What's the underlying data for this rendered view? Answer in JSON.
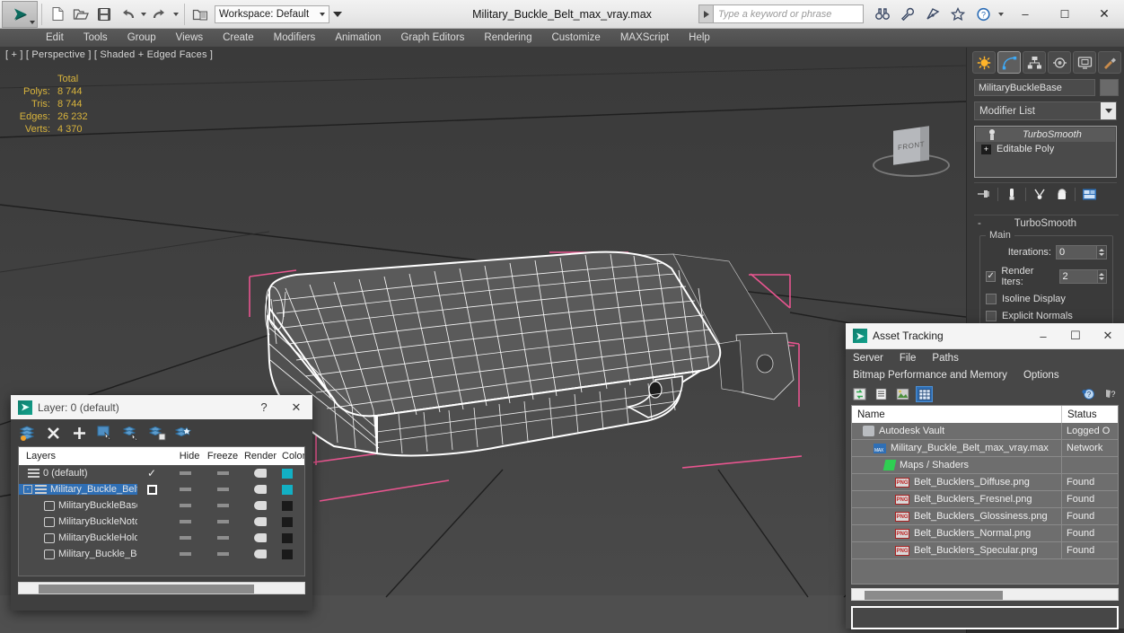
{
  "titlebar": {
    "app_logo": "3dsmax-logo",
    "document_title": "Military_Buckle_Belt_max_vray.max",
    "workspace_label": "Workspace: Default",
    "search_placeholder": "Type a keyword or phrase",
    "quick_buttons": [
      "new-icon",
      "open-icon",
      "save-icon",
      "undo-icon",
      "redo-icon",
      "set-project-icon"
    ],
    "help_icons": [
      "binoculars-icon",
      "wrench-icon",
      "satellite-icon",
      "star-icon",
      "help-icon"
    ],
    "window_buttons": {
      "minimize": "–",
      "maximize": "☐",
      "close": "✕"
    }
  },
  "menubar": {
    "items": [
      "Edit",
      "Tools",
      "Group",
      "Views",
      "Create",
      "Modifiers",
      "Animation",
      "Graph Editors",
      "Rendering",
      "Customize",
      "MAXScript",
      "Help"
    ]
  },
  "viewport": {
    "label": "[ + ] [ Perspective ] [ Shaded + Edged Faces ]",
    "stats": {
      "header": "Total",
      "rows": [
        {
          "key": "Polys:",
          "value": "8 744"
        },
        {
          "key": "Tris:",
          "value": "8 744"
        },
        {
          "key": "Edges:",
          "value": "26 232"
        },
        {
          "key": "Verts:",
          "value": "4 370"
        }
      ]
    },
    "viewcube_label": "FRONT",
    "selection_color": "#e8558f",
    "wire_color": "#ffffff"
  },
  "command_panel": {
    "tabs": [
      "create-tab-icon",
      "modify-tab-icon",
      "hierarchy-tab-icon",
      "motion-tab-icon",
      "display-tab-icon",
      "utilities-tab-icon"
    ],
    "selected_tab_index": 1,
    "object_name": "MilitaryBuckleBase",
    "modifier_list_label": "Modifier List",
    "stack": [
      {
        "label": "TurboSmooth",
        "icon": "lightbulb-icon",
        "selected": true,
        "italic": true
      },
      {
        "label": "Editable Poly",
        "icon": "plus-box-icon",
        "selected": false,
        "italic": false
      }
    ],
    "stack_tools": [
      "pin-stack-icon",
      "show-end-result-icon",
      "make-unique-icon",
      "remove-modifier-icon",
      "configure-sets-icon"
    ],
    "rollout": {
      "title": "TurboSmooth",
      "collapse_glyph": "-",
      "group_label": "Main",
      "iterations_label": "Iterations:",
      "iterations_value": "0",
      "render_iters_label": "Render Iters:",
      "render_iters_value": "2",
      "render_iters_checked": true,
      "isoline_label": "Isoline Display",
      "isoline_checked": false,
      "explicit_normals_label": "Explicit Normals",
      "explicit_normals_checked": false
    }
  },
  "asset_tracking": {
    "title": "Asset Tracking",
    "window_buttons": {
      "minimize": "–",
      "maximize": "☐",
      "close": "✕"
    },
    "menu_row1": [
      "Server",
      "File",
      "Paths"
    ],
    "menu_row2": [
      "Bitmap Performance and Memory",
      "Options"
    ],
    "toolbar_icons": [
      "refresh-icon",
      "list-view-icon",
      "thumbnail-view-icon",
      "grid-view-icon"
    ],
    "help_icons": [
      "help-icon",
      "context-help-icon"
    ],
    "columns": [
      "Name",
      "Status"
    ],
    "rows": [
      {
        "name": "Autodesk Vault",
        "status": "Logged O",
        "icon": "vault-icon",
        "indent": 1
      },
      {
        "name": "Military_Buckle_Belt_max_vray.max",
        "status": "Network",
        "icon": "max-file-icon",
        "indent": 2
      },
      {
        "name": "Maps / Shaders",
        "status": "",
        "icon": "maps-icon",
        "indent": 3
      },
      {
        "name": "Belt_Bucklers_Diffuse.png",
        "status": "Found",
        "icon": "png-icon",
        "indent": 4
      },
      {
        "name": "Belt_Bucklers_Fresnel.png",
        "status": "Found",
        "icon": "png-icon",
        "indent": 4
      },
      {
        "name": "Belt_Bucklers_Glossiness.png",
        "status": "Found",
        "icon": "png-icon",
        "indent": 4
      },
      {
        "name": "Belt_Bucklers_Normal.png",
        "status": "Found",
        "icon": "png-icon",
        "indent": 4
      },
      {
        "name": "Belt_Bucklers_Specular.png",
        "status": "Found",
        "icon": "png-icon",
        "indent": 4
      }
    ]
  },
  "layer_dialog": {
    "title": "Layer: 0 (default)",
    "help_glyph": "?",
    "close_glyph": "✕",
    "toolbar_icons": [
      "new-layer-icon",
      "delete-layer-icon",
      "add-layer-icon",
      "select-objects-icon",
      "highlight-selected-icon",
      "add-selection-icon",
      "select-highlighted-icon"
    ],
    "columns": [
      "Layers",
      "Hide",
      "Freeze",
      "Render",
      "Color"
    ],
    "rows": [
      {
        "name": "0 (default)",
        "indent": 1,
        "icon": "layer-icon",
        "selected": false,
        "current": true,
        "color": "#12b0c4",
        "expander": ""
      },
      {
        "name": "Military_Buckle_Belt",
        "indent": 1,
        "icon": "layer-icon",
        "selected": true,
        "current": false,
        "color": "#12b0c4",
        "expander": "-"
      },
      {
        "name": "MilitaryBuckleBase",
        "indent": 2,
        "icon": "object-icon",
        "selected": false,
        "current": false,
        "color": "#1a1a1a",
        "expander": ""
      },
      {
        "name": "MilitaryBuckleNotched",
        "indent": 2,
        "icon": "object-icon",
        "selected": false,
        "current": false,
        "color": "#1a1a1a",
        "expander": ""
      },
      {
        "name": "MilitaryBuckleHolder",
        "indent": 2,
        "icon": "object-icon",
        "selected": false,
        "current": false,
        "color": "#1a1a1a",
        "expander": ""
      },
      {
        "name": "Military_Buckle_Belt",
        "indent": 2,
        "icon": "object-icon",
        "selected": false,
        "current": false,
        "color": "#1a1a1a",
        "expander": ""
      }
    ]
  }
}
